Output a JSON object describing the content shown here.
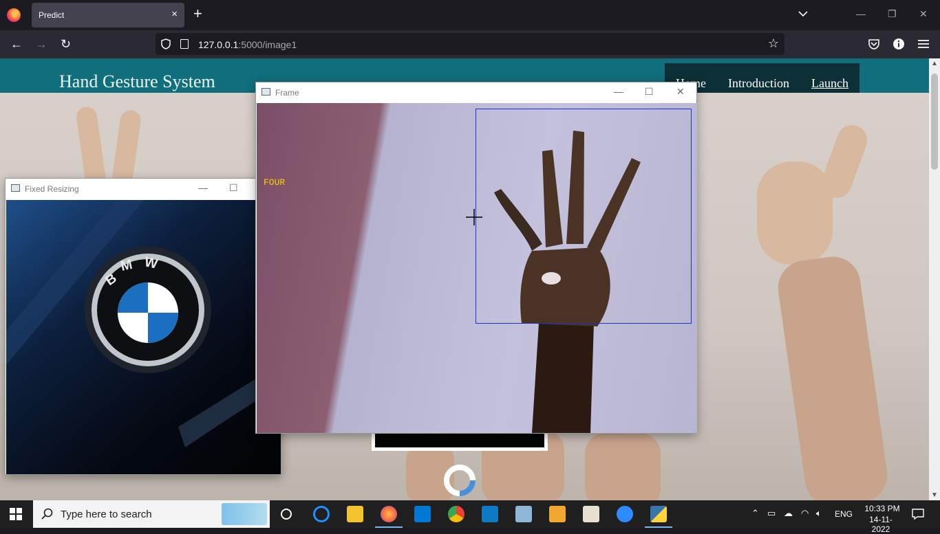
{
  "browser": {
    "tab_title": "Predict",
    "tab_close": "×",
    "new_tab": "+",
    "url_host": "127.0.0.1",
    "url_path": ":5000/image1",
    "back": "←",
    "forward": "→",
    "reload": "↻",
    "bookmark_star": "☆",
    "window_minimize": "—",
    "window_restore": "❐",
    "window_close": "✕"
  },
  "site": {
    "title": "Hand Gesture System",
    "nav": [
      {
        "label": "Home"
      },
      {
        "label": "Introduction"
      },
      {
        "label": "Launch"
      }
    ]
  },
  "windows": {
    "fixed_resizing": {
      "title": "Fixed Resizing",
      "image": "bmw-emblem-photo"
    },
    "frame": {
      "title": "Frame",
      "prediction_label": "FOUR",
      "roi_color": "#1b2fe0"
    }
  },
  "taskbar": {
    "search_placeholder": "Type here to search",
    "language": "ENG",
    "time": "10:33 PM",
    "date": "14-11-2022"
  },
  "colors": {
    "header_teal": "#116e7c",
    "nav_dark": "#0c3036",
    "label_yellow": "#ffd200"
  }
}
